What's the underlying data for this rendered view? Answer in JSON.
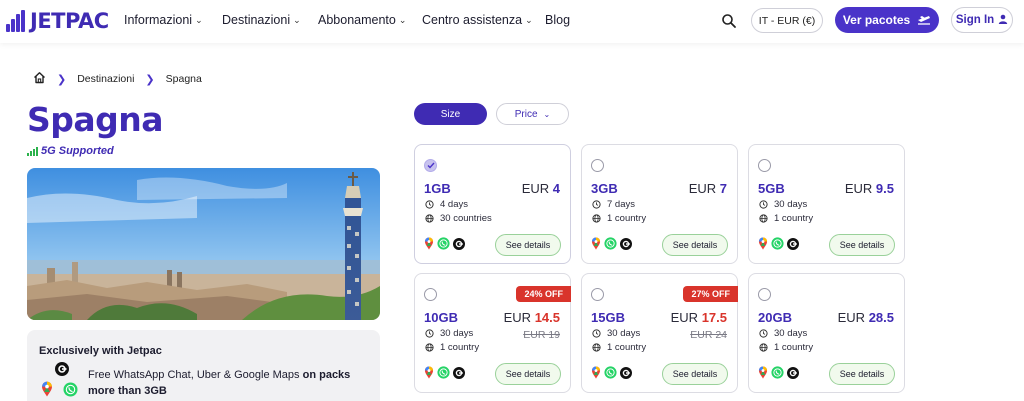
{
  "header": {
    "brand": "JETPAC",
    "nav": [
      {
        "label": "Informazioni",
        "has_dropdown": true
      },
      {
        "label": "Destinazioni",
        "has_dropdown": true
      },
      {
        "label": "Abbonamento",
        "has_dropdown": true
      },
      {
        "label": "Centro assistenza",
        "has_dropdown": true
      },
      {
        "label": "Blog",
        "has_dropdown": false
      }
    ],
    "search_icon": "search-icon",
    "locale": "IT - EUR (€)",
    "cta_label": "Ver pacotes",
    "signin_label": "Sign In"
  },
  "breadcrumb": {
    "home_icon": "home-icon",
    "items": [
      "Destinazioni",
      "Spagna"
    ]
  },
  "destination": {
    "title": "Spagna",
    "network_badge": "5G Supported",
    "hero_alt": "Barcelona skyline photo"
  },
  "exclusive": {
    "title": "Exclusively with Jetpac",
    "text_plain": "Free WhatsApp Chat, Uber & Google Maps ",
    "text_bold": "on packs more than 3GB"
  },
  "filters": {
    "size_label": "Size",
    "price_label": "Price"
  },
  "currency": "EUR",
  "details_label": "See details",
  "colors": {
    "brand": "#3f2bb3",
    "accent": "#4a33c9",
    "sale": "#d9342b",
    "details_border": "#9ad19a"
  },
  "plans": [
    {
      "size": "1GB",
      "price": "4",
      "old_price": "",
      "discount": "",
      "duration": "4 days",
      "coverage": "30 countries",
      "selected": true
    },
    {
      "size": "3GB",
      "price": "7",
      "old_price": "",
      "discount": "",
      "duration": "7 days",
      "coverage": "1 country",
      "selected": false
    },
    {
      "size": "5GB",
      "price": "9.5",
      "old_price": "",
      "discount": "",
      "duration": "30 days",
      "coverage": "1 country",
      "selected": false
    },
    {
      "size": "10GB",
      "price": "14.5",
      "old_price": "EUR 19",
      "discount": "24% OFF",
      "duration": "30 days",
      "coverage": "1 country",
      "selected": false
    },
    {
      "size": "15GB",
      "price": "17.5",
      "old_price": "EUR 24",
      "discount": "27% OFF",
      "duration": "30 days",
      "coverage": "1 country",
      "selected": false
    },
    {
      "size": "20GB",
      "price": "28.5",
      "old_price": "",
      "discount": "",
      "duration": "30 days",
      "coverage": "1 country",
      "selected": false
    }
  ],
  "app_icons": [
    "maps-icon",
    "whatsapp-icon",
    "uber-icon"
  ]
}
